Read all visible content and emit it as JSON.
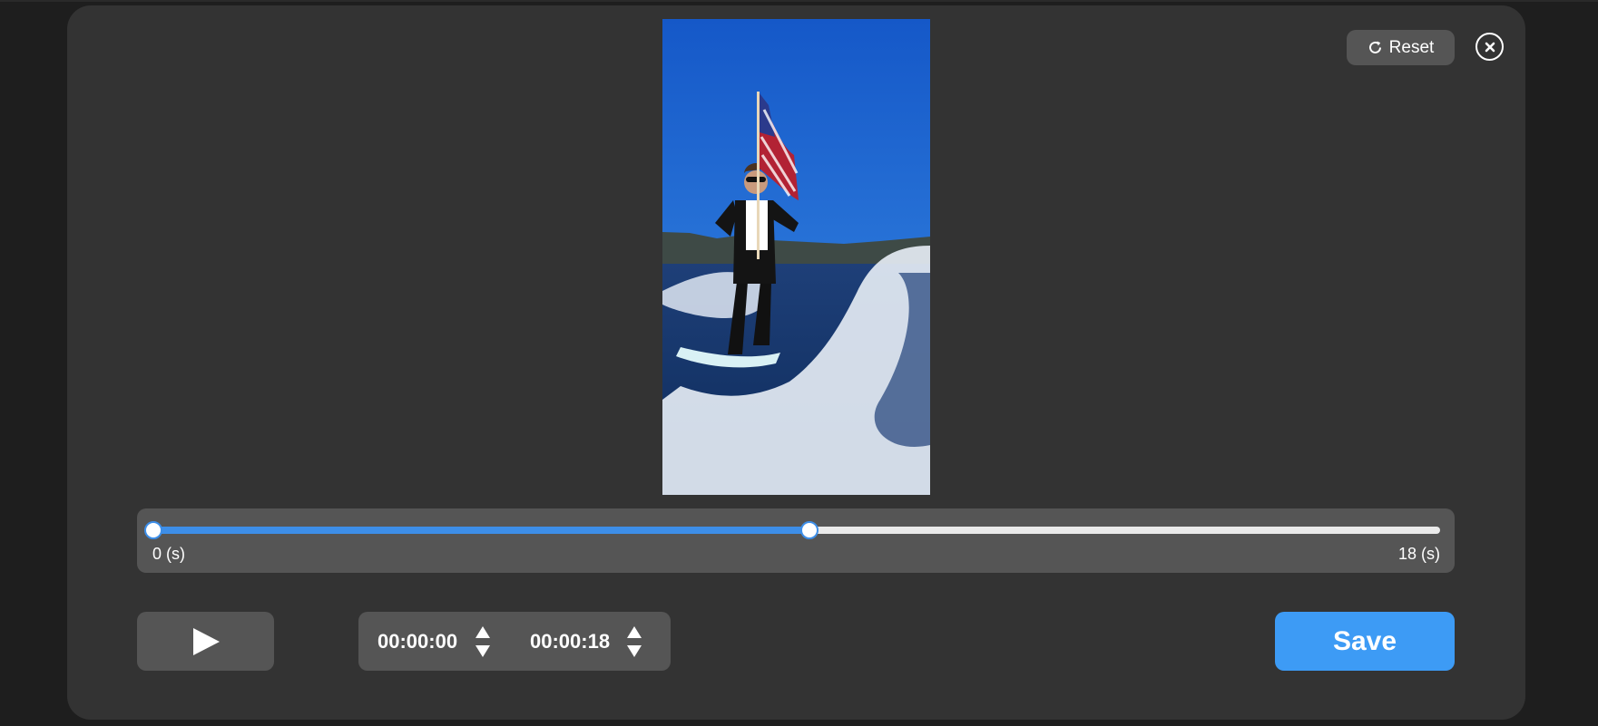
{
  "toolbar": {
    "reset_label": "Reset"
  },
  "icons": {
    "reset": "refresh-icon",
    "close": "close-circle-icon",
    "play": "play-icon",
    "spinner": "up-down-arrow-icon"
  },
  "slider": {
    "min_label": "0 (s)",
    "max_label": "18 (s)",
    "start_fraction": 0,
    "end_fraction": 0.51,
    "fill_color": "#3d8ee8"
  },
  "time": {
    "start": "00:00:00",
    "end": "00:00:18"
  },
  "actions": {
    "save_label": "Save"
  },
  "colors": {
    "accent": "#3d9bf5",
    "panel": "#555555",
    "modal": "#333333"
  },
  "preview": {
    "description_icon": "video-preview"
  }
}
